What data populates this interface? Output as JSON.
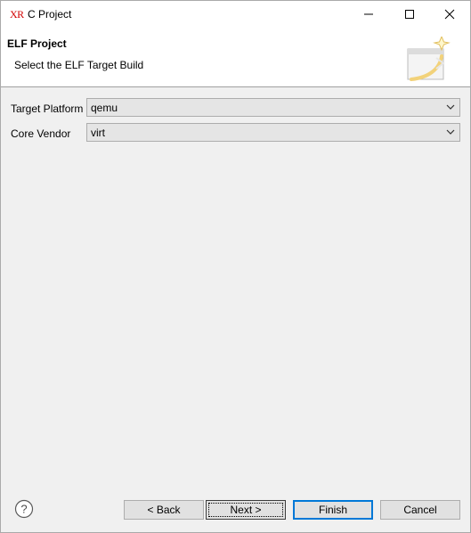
{
  "window": {
    "app_icon_text": "XR",
    "title": "C Project",
    "icons": {
      "minimize": "minimize-icon",
      "maximize": "maximize-icon",
      "close": "close-icon"
    }
  },
  "banner": {
    "title": "ELF Project",
    "description": "Select the ELF Target Build",
    "graphic": "wizard-banner-icon"
  },
  "form": {
    "target_platform": {
      "label": "Target Platform",
      "value": "qemu"
    },
    "core_vendor": {
      "label": "Core Vendor",
      "value": "virt"
    }
  },
  "footer": {
    "help_icon": "help-icon",
    "back_label": "< Back",
    "next_label": "Next >",
    "finish_label": "Finish",
    "cancel_label": "Cancel"
  },
  "colors": {
    "accent": "#0078d7",
    "icon_red": "#d10000"
  }
}
